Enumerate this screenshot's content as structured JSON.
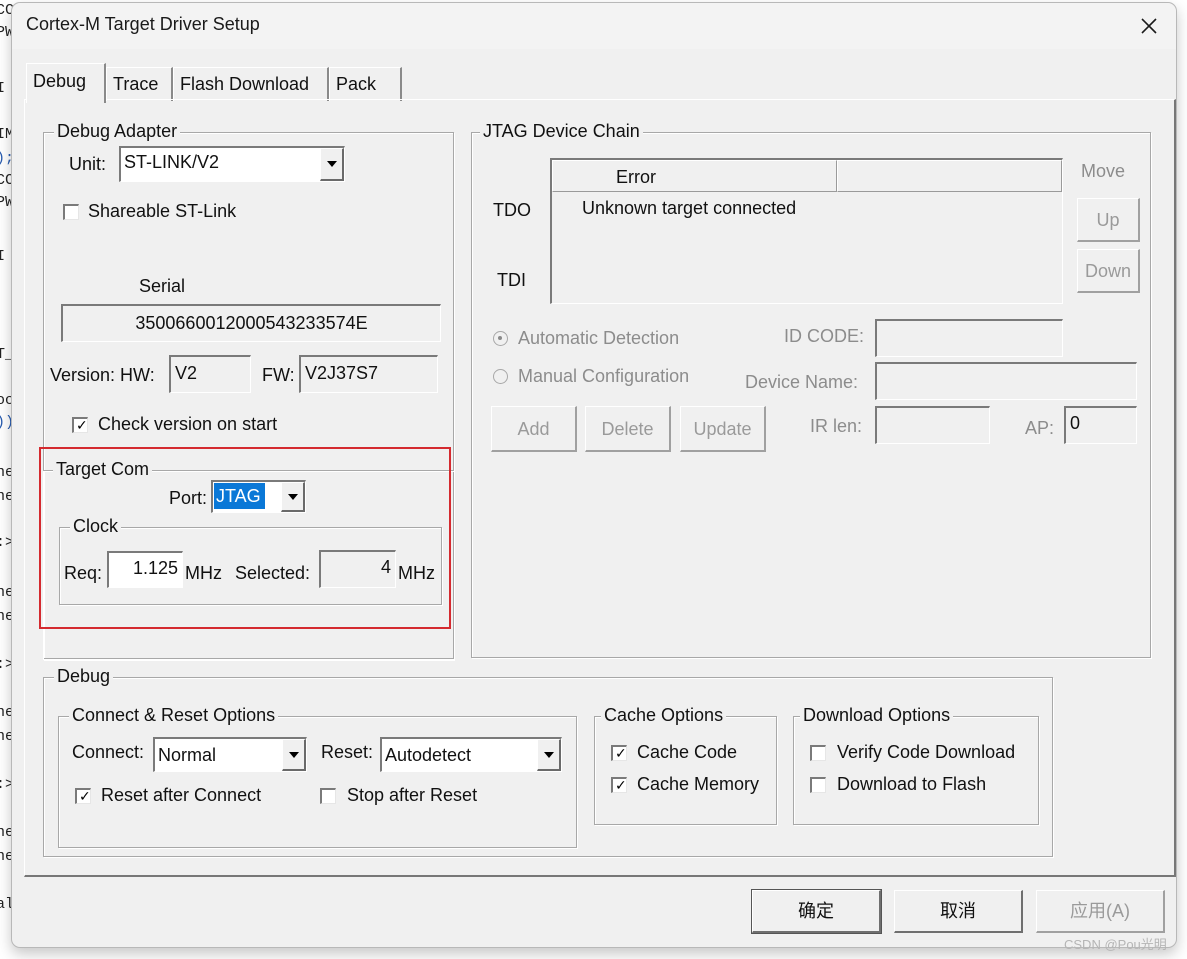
{
  "window": {
    "title": "Cortex-M Target Driver Setup",
    "close_icon": "close-icon"
  },
  "tabs": [
    {
      "label": "Debug",
      "active": true
    },
    {
      "label": "Trace",
      "active": false
    },
    {
      "label": "Flash Download",
      "active": false
    },
    {
      "label": "Pack",
      "active": false
    }
  ],
  "debug_adapter": {
    "legend": "Debug Adapter",
    "unit_label": "Unit:",
    "unit_value": "ST-LINK/V2",
    "shareable_label": "Shareable ST-Link",
    "shareable_checked": false,
    "serial_label": "Serial",
    "serial_value": "3500660012000543233574E",
    "version_label": "Version: HW:",
    "hw_value": "V2",
    "fw_label": "FW:",
    "fw_value": "V2J37S7",
    "check_version_label": "Check version on start",
    "check_version_checked": true
  },
  "target_com": {
    "legend": "Target Com",
    "port_label": "Port:",
    "port_value": "JTAG",
    "clock": {
      "legend": "Clock",
      "req_label": "Req:",
      "req_value": "1.125",
      "req_unit": "MHz",
      "selected_label": "Selected:",
      "selected_value": "4",
      "selected_unit": "MHz"
    }
  },
  "jtag_chain": {
    "legend": "JTAG Device Chain",
    "tdo_label": "TDO",
    "tdi_label": "TDI",
    "columns": [
      "Error",
      ""
    ],
    "rows": [
      [
        "Unknown target connected",
        ""
      ]
    ],
    "move_label": "Move",
    "up_label": "Up",
    "down_label": "Down",
    "auto_detect_label": "Automatic Detection",
    "auto_detect_selected": true,
    "manual_config_label": "Manual Configuration",
    "id_code_label": "ID CODE:",
    "id_code_value": "",
    "device_name_label": "Device Name:",
    "device_name_value": "",
    "add_label": "Add",
    "delete_label": "Delete",
    "update_label": "Update",
    "ir_len_label": "IR len:",
    "ir_len_value": "",
    "ap_label": "AP:",
    "ap_value": "0"
  },
  "debug": {
    "legend": "Debug",
    "connect_reset": {
      "legend": "Connect & Reset Options",
      "connect_label": "Connect:",
      "connect_value": "Normal",
      "reset_label": "Reset:",
      "reset_value": "Autodetect",
      "reset_after_connect_label": "Reset after Connect",
      "reset_after_connect_checked": true,
      "stop_after_reset_label": "Stop after Reset",
      "stop_after_reset_checked": false
    },
    "cache": {
      "legend": "Cache Options",
      "cache_code_label": "Cache Code",
      "cache_code_checked": true,
      "cache_memory_label": "Cache Memory",
      "cache_memory_checked": true
    },
    "download": {
      "legend": "Download Options",
      "verify_label": "Verify Code Download",
      "verify_checked": false,
      "download_flash_label": "Download to Flash",
      "download_flash_checked": false
    }
  },
  "footer": {
    "ok_label": "确定",
    "cancel_label": "取消",
    "apply_label": "应用(A)"
  },
  "watermark": "CSDN @Pou光明",
  "colors": {
    "highlight_border": "#d42a2f",
    "selection": "#0a78d7",
    "dialog_bg": "#f0f0f0"
  },
  "background_code": {
    "lines": [
      "CC",
      "PW",
      "I",
      "IM",
      ");",
      "CC",
      "PW",
      "I",
      "T_",
      "oc",
      "))",
      "ne",
      "ne",
      ":>",
      "ne",
      "ne",
      ":>",
      "ne",
      "ne",
      ":>",
      "ne",
      "ne",
      "al"
    ]
  }
}
